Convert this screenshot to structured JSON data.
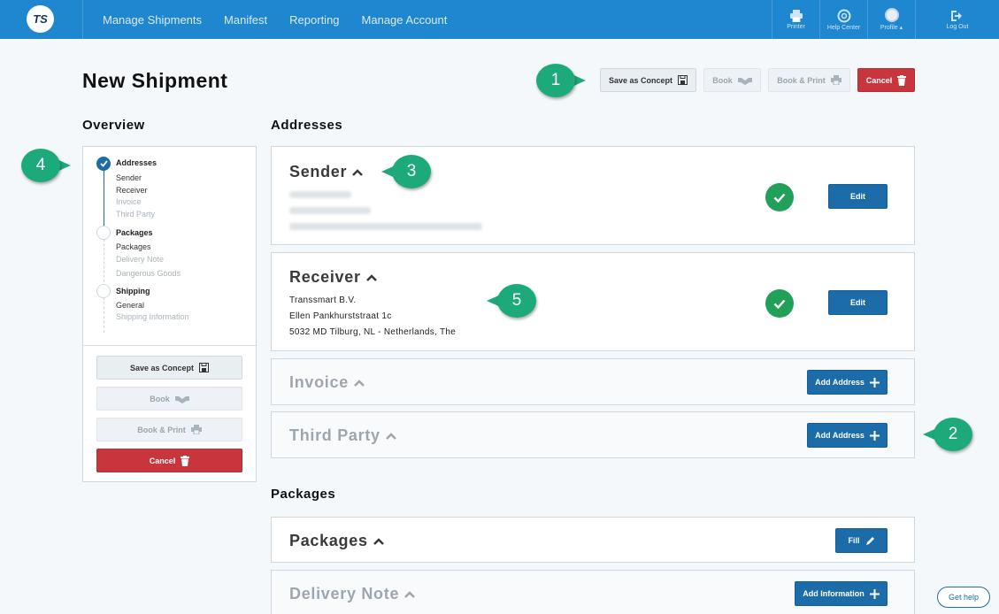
{
  "logo": {
    "text": "TS"
  },
  "nav": {
    "items": [
      "Manage Shipments",
      "Manifest",
      "Reporting",
      "Manage Account"
    ]
  },
  "toolbar": {
    "printer": "Printer",
    "help_center": "Help Center",
    "profile": "Profile ▴",
    "logout": "Log Out"
  },
  "page": {
    "title": "New Shipment"
  },
  "actions": {
    "save_concept": "Save as Concept",
    "book": "Book",
    "book_print": "Book & Print",
    "cancel": "Cancel"
  },
  "overview": {
    "label": "Overview",
    "groups": [
      {
        "title": "Addresses",
        "items": [
          "Sender",
          "Receiver",
          "Invoice",
          "Third Party"
        ]
      },
      {
        "title": "Packages",
        "items": [
          "Packages",
          "Delivery Note",
          "Dangerous Goods"
        ]
      },
      {
        "title": "Shipping",
        "items": [
          "General",
          "Shipping Information"
        ]
      }
    ]
  },
  "sections": {
    "addresses": "Addresses",
    "packages": "Packages"
  },
  "sender": {
    "title": "Sender",
    "edit": "Edit"
  },
  "receiver": {
    "title": "Receiver",
    "lines": [
      "Transsmart B.V.",
      "Ellen Pankhurststraat 1c",
      "5032 MD Tilburg, NL - Netherlands, The"
    ],
    "edit": "Edit"
  },
  "invoice": {
    "title": "Invoice",
    "button": "Add Address"
  },
  "third_party": {
    "title": "Third Party",
    "button": "Add Address"
  },
  "packages_card": {
    "title": "Packages",
    "button": "Fill"
  },
  "delivery_note": {
    "title": "Delivery Note",
    "button": "Add Information"
  },
  "callouts": [
    "1",
    "2",
    "3",
    "4",
    "5"
  ],
  "help": {
    "label": "Get help"
  },
  "colors": {
    "topbar": "#1f86d0",
    "primary": "#1b6ca8",
    "danger": "#c9353c",
    "success": "#21a05a",
    "callout": "#1daa7a"
  }
}
